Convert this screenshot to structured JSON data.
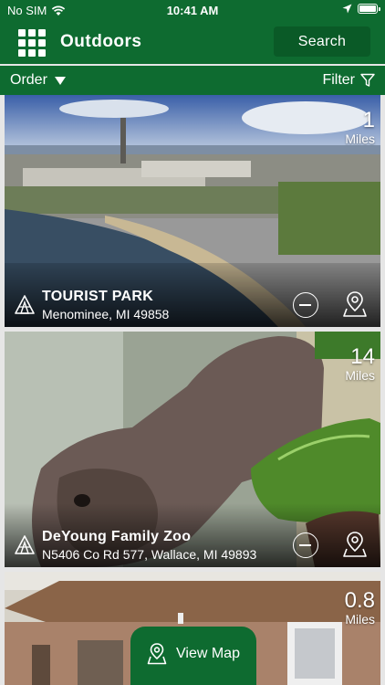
{
  "status_bar": {
    "carrier": "No SIM",
    "time": "10:41 AM"
  },
  "header": {
    "title": "Outdoors",
    "search_label": "Search",
    "menu_icon": "grid-menu-icon"
  },
  "toolbar": {
    "order_label": "Order",
    "filter_label": "Filter"
  },
  "cards": [
    {
      "name": "TOURIST PARK",
      "address": "Menominee, MI 49858",
      "distance": "1",
      "unit": "Miles"
    },
    {
      "name": "DeYoung Family Zoo",
      "address": "N5406 Co Rd 577, Wallace, MI 49893",
      "distance": "14",
      "unit": "Miles"
    },
    {
      "name": "",
      "address": "",
      "distance": "0.8",
      "unit": "Miles"
    }
  ],
  "view_map": {
    "label": "View Map"
  },
  "colors": {
    "brand_green": "#0e6b30",
    "button_green": "#0a5a27"
  }
}
